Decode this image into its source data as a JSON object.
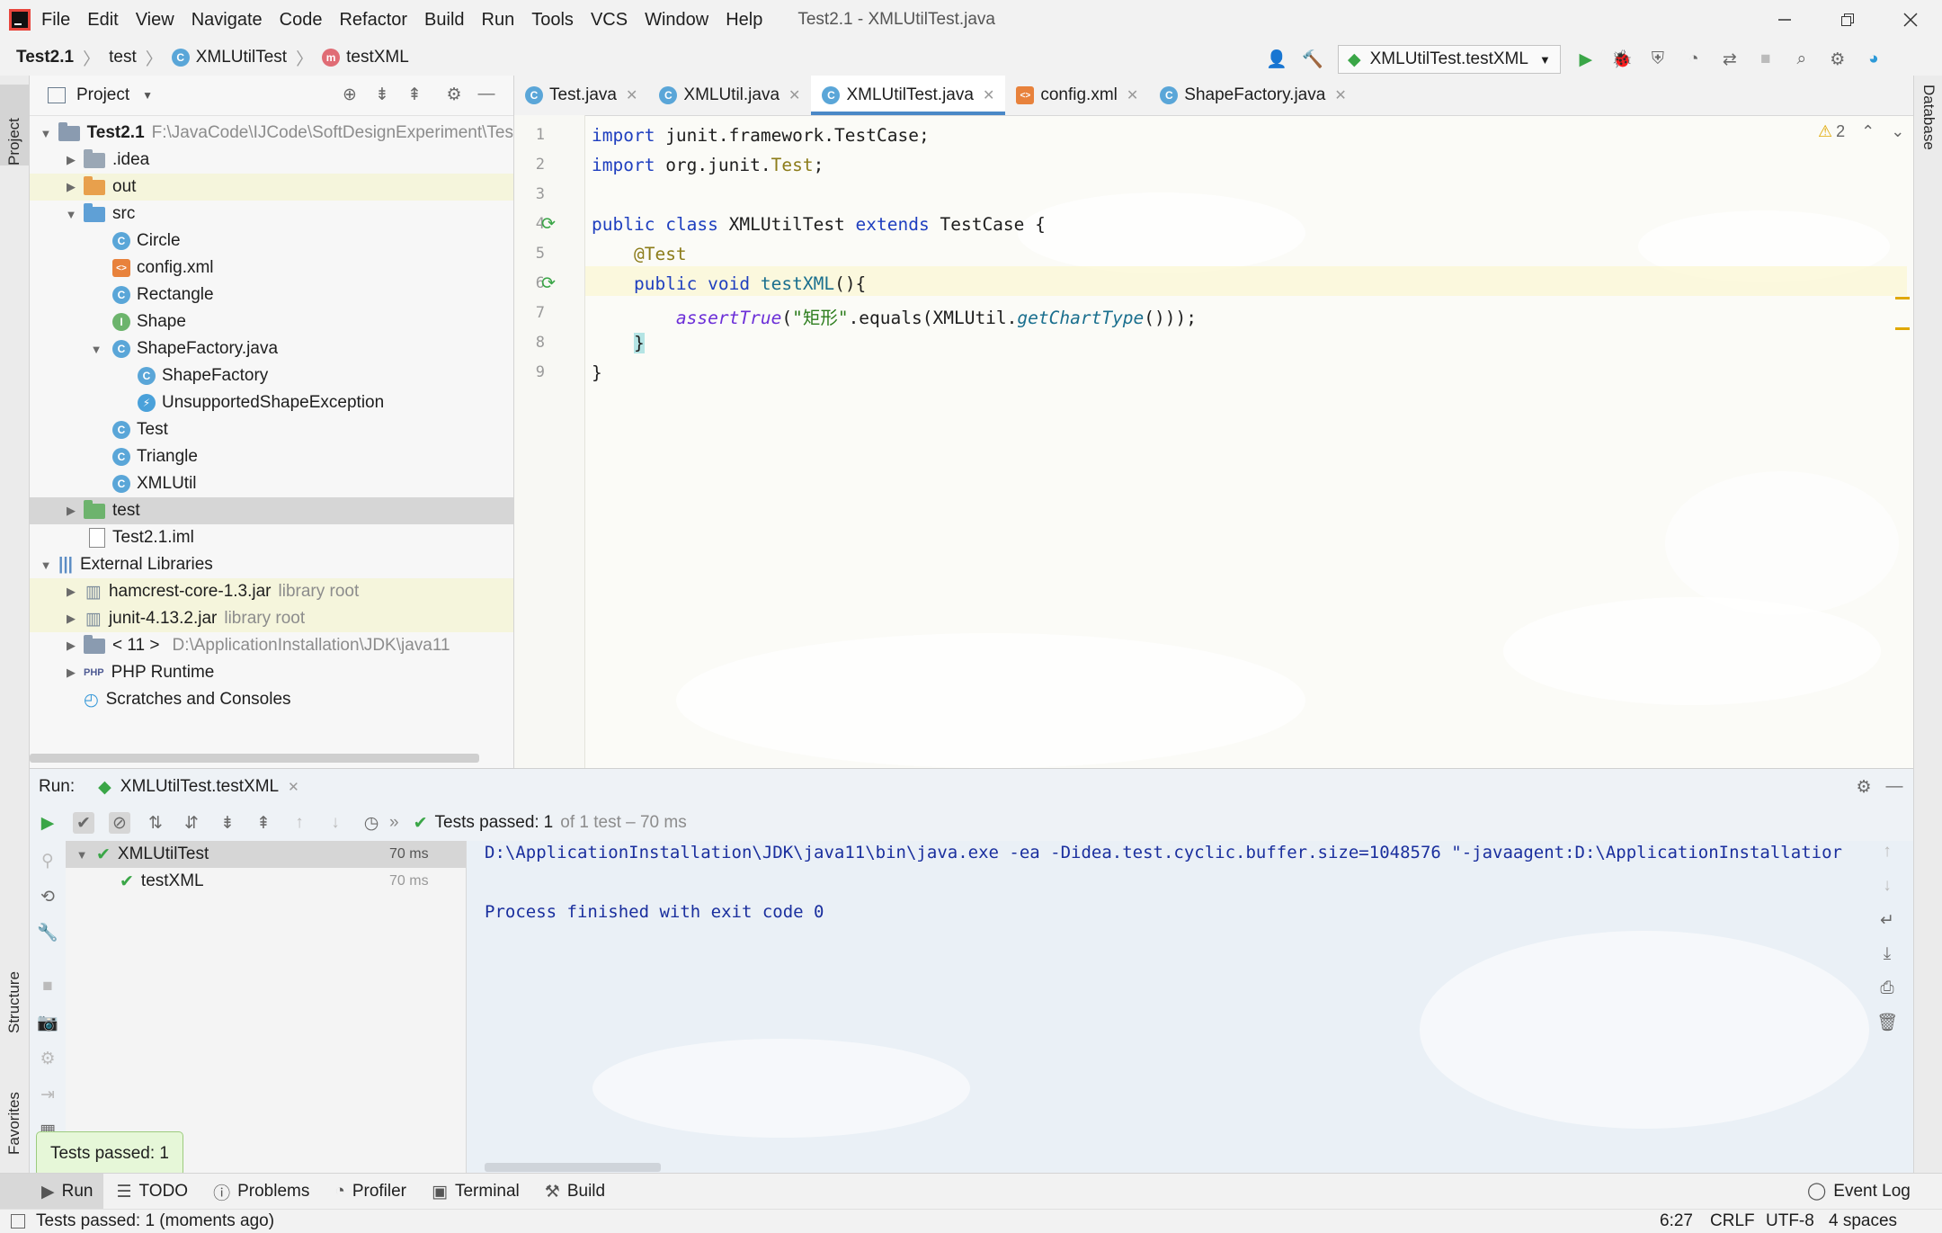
{
  "menu": [
    "File",
    "Edit",
    "View",
    "Navigate",
    "Code",
    "Refactor",
    "Build",
    "Run",
    "Tools",
    "VCS",
    "Window",
    "Help"
  ],
  "window_title": "Test2.1 - XMLUtilTest.java",
  "breadcrumb": [
    "Test2.1",
    "test",
    "XMLUtilTest",
    "testXML"
  ],
  "run_config": "XMLUtilTest.testXML",
  "project_panel": {
    "title": "Project",
    "tree": [
      {
        "label": "Test2.1",
        "hint": "F:\\JavaCode\\IJCode\\SoftDesignExperiment\\Tes",
        "bold": true
      },
      {
        "label": ".idea"
      },
      {
        "label": "out"
      },
      {
        "label": "src"
      },
      {
        "label": "Circle"
      },
      {
        "label": "config.xml"
      },
      {
        "label": "Rectangle"
      },
      {
        "label": "Shape"
      },
      {
        "label": "ShapeFactory.java"
      },
      {
        "label": "ShapeFactory"
      },
      {
        "label": "UnsupportedShapeException"
      },
      {
        "label": "Test"
      },
      {
        "label": "Triangle"
      },
      {
        "label": "XMLUtil"
      },
      {
        "label": "test"
      },
      {
        "label": "Test2.1.iml"
      },
      {
        "label": "External Libraries"
      },
      {
        "label": "hamcrest-core-1.3.jar",
        "hint": "library root"
      },
      {
        "label": "junit-4.13.2.jar",
        "hint": "library root"
      },
      {
        "label": "< 11 >",
        "hint": "D:\\ApplicationInstallation\\JDK\\java11"
      },
      {
        "label": "PHP Runtime"
      },
      {
        "label": "Scratches and Consoles"
      }
    ]
  },
  "editor_tabs": [
    "Test.java",
    "XMLUtil.java",
    "XMLUtilTest.java",
    "config.xml",
    "ShapeFactory.java"
  ],
  "code": {
    "line_numbers": [
      "1",
      "2",
      "3",
      "4",
      "5",
      "6",
      "7",
      "8",
      "9"
    ],
    "l1": {
      "kw": "import",
      "rest": " junit.framework.TestCase;"
    },
    "l2": {
      "kw": "import",
      "rest": " org.junit.",
      "cls": "Test",
      ";": ";"
    },
    "l4": {
      "kw1": "public",
      "kw2": "class",
      "name": "XMLUtilTest",
      "kw3": "extends",
      "rest": "TestCase {"
    },
    "l5": "@Test",
    "l6": {
      "kw1": "public",
      "kw2": "void",
      "name": "testXML",
      "rest": "(){"
    },
    "l7": {
      "call": "assertTrue",
      "str": "\"矩形\"",
      "rest1": ".equals(XMLUtil.",
      "call2": "getChartType",
      "rest2": "()));"
    },
    "l8": "}",
    "l9": "}"
  },
  "warnings": "2",
  "run_panel": {
    "label": "Run:",
    "tab": "XMLUtilTest.testXML",
    "status_prefix": "Tests passed:",
    "passed": "1",
    "status_suffix": "of 1 test – 70 ms",
    "tree": [
      {
        "label": "XMLUtilTest",
        "time": "70 ms"
      },
      {
        "label": "testXML",
        "time": "70 ms"
      }
    ],
    "console": [
      "D:\\ApplicationInstallation\\JDK\\java11\\bin\\java.exe -ea -Didea.test.cyclic.buffer.size=1048576 \"-javaagent:D:\\ApplicationInstallatior",
      "",
      "Process finished with exit code 0"
    ]
  },
  "toast": "Tests passed: 1",
  "tool_windows": [
    "Run",
    "TODO",
    "Problems",
    "Profiler",
    "Terminal",
    "Build"
  ],
  "event_log": "Event Log",
  "left_stripe": {
    "project": "Project",
    "structure": "Structure",
    "favorites": "Favorites"
  },
  "right_stripe": {
    "database": "Database"
  },
  "status": {
    "message": "Tests passed: 1 (moments ago)",
    "position": "6:27",
    "line_sep": "CRLF",
    "encoding": "UTF-8",
    "indent": "4 spaces"
  },
  "colors": {
    "accent": "#4a88c7",
    "pass": "#3aa647",
    "keyword": "#1f3fbf",
    "string": "#2d7d1e"
  }
}
